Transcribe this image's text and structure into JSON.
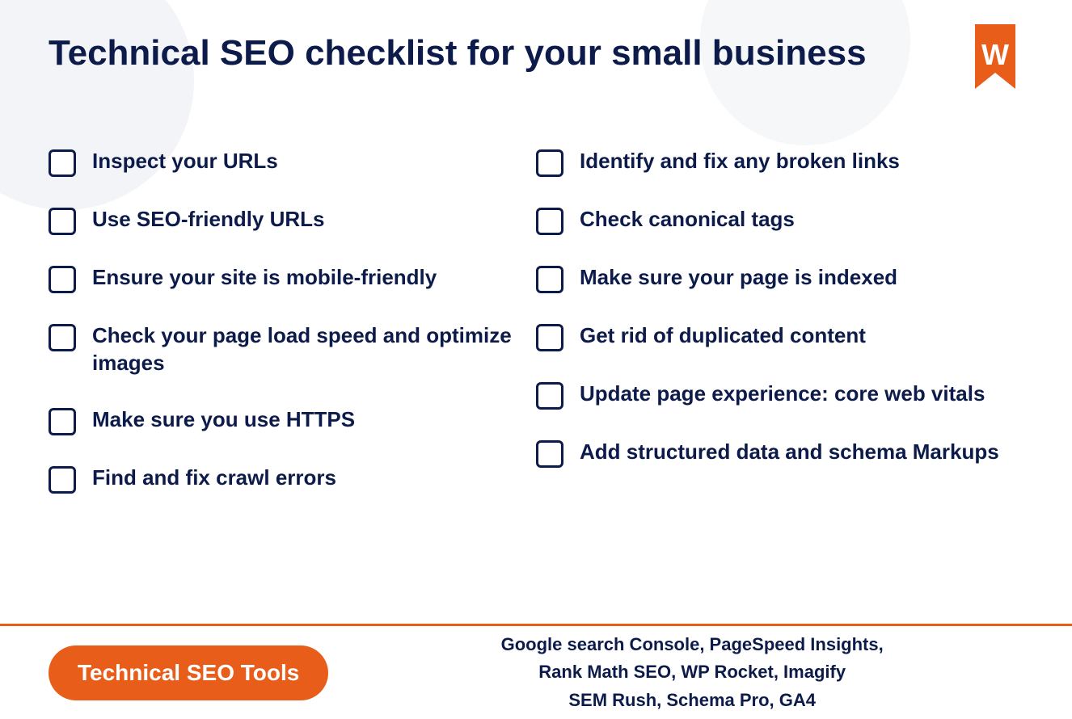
{
  "page": {
    "title": "Technical SEO checklist for your small business",
    "background_color": "#ffffff"
  },
  "logo": {
    "alt": "W logo icon"
  },
  "checklist": {
    "left_column": [
      {
        "id": 1,
        "label": "Inspect your URLs"
      },
      {
        "id": 2,
        "label": "Use SEO-friendly URLs"
      },
      {
        "id": 3,
        "label": "Ensure your site is mobile-friendly"
      },
      {
        "id": 4,
        "label": "Check your page load speed and optimize images"
      },
      {
        "id": 5,
        "label": "Make sure you use HTTPS"
      },
      {
        "id": 6,
        "label": "Find and fix crawl errors"
      }
    ],
    "right_column": [
      {
        "id": 7,
        "label": "Identify and fix any broken links"
      },
      {
        "id": 8,
        "label": "Check canonical tags"
      },
      {
        "id": 9,
        "label": "Make sure your page is indexed"
      },
      {
        "id": 10,
        "label": "Get rid of duplicated content"
      },
      {
        "id": 11,
        "label": "Update page experience: core web vitals"
      },
      {
        "id": 12,
        "label": "Add structured data and schema Markups"
      }
    ]
  },
  "footer": {
    "badge_label": "Technical SEO Tools",
    "tools_line1": "Google search Console, PageSpeed Insights,",
    "tools_line2": "Rank Math SEO, WP Rocket, Imagify",
    "tools_line3": "SEM Rush, Schema Pro, GA4"
  }
}
